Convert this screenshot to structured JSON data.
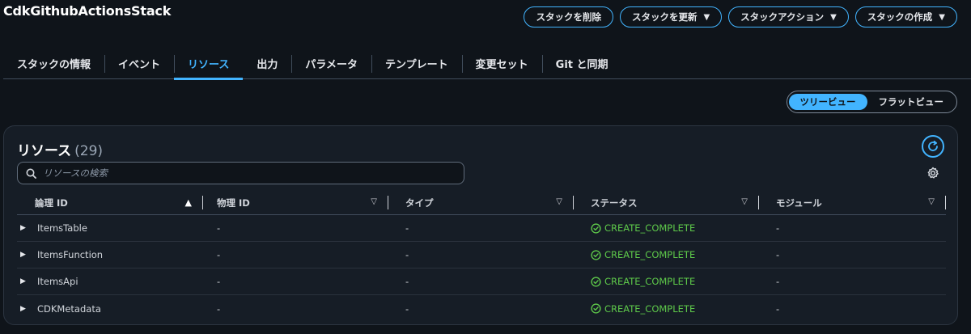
{
  "stack": {
    "title": "CdkGithubActionsStack"
  },
  "actions": [
    {
      "label": "スタックを削除",
      "dropdown": false
    },
    {
      "label": "スタックを更新",
      "dropdown": true
    },
    {
      "label": "スタックアクション",
      "dropdown": true
    },
    {
      "label": "スタックの作成",
      "dropdown": true
    }
  ],
  "tabs": [
    {
      "label": "スタックの情報",
      "active": false
    },
    {
      "label": "イベント",
      "active": false
    },
    {
      "label": "リソース",
      "active": true
    },
    {
      "label": "出力",
      "active": false
    },
    {
      "label": "パラメータ",
      "active": false
    },
    {
      "label": "テンプレート",
      "active": false
    },
    {
      "label": "変更セット",
      "active": false
    },
    {
      "label": "Git と同期",
      "active": false
    }
  ],
  "view_toggle": {
    "tree": "ツリービュー",
    "flat": "フラットビュー",
    "selected": "tree"
  },
  "resources": {
    "title": "リソース",
    "count": "(29)",
    "search_placeholder": "リソースの検索",
    "columns": [
      "論理 ID",
      "物理 ID",
      "タイプ",
      "ステータス",
      "モジュール"
    ],
    "rows": [
      {
        "logical_id": "ItemsTable",
        "physical_id": "-",
        "type": "-",
        "status": "CREATE_COMPLETE",
        "module": "-"
      },
      {
        "logical_id": "ItemsFunction",
        "physical_id": "-",
        "type": "-",
        "status": "CREATE_COMPLETE",
        "module": "-"
      },
      {
        "logical_id": "ItemsApi",
        "physical_id": "-",
        "type": "-",
        "status": "CREATE_COMPLETE",
        "module": "-"
      },
      {
        "logical_id": "CDKMetadata",
        "physical_id": "-",
        "type": "-",
        "status": "CREATE_COMPLETE",
        "module": "-"
      }
    ]
  },
  "colors": {
    "accent": "#42b4ff",
    "success": "#5ec94a",
    "background": "#0f141a",
    "panel": "#161d26"
  },
  "icons": {
    "refresh": "refresh-icon",
    "search": "search-icon",
    "settings": "gear-icon",
    "status": "check-circle-icon"
  }
}
